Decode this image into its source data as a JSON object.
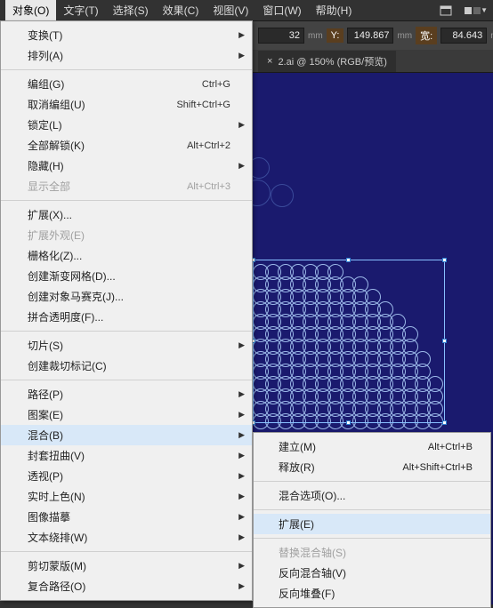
{
  "menubar": {
    "items": [
      "对象(O)",
      "文字(T)",
      "选择(S)",
      "效果(C)",
      "视图(V)",
      "窗口(W)",
      "帮助(H)"
    ]
  },
  "ctrl": {
    "x_val": "32",
    "x_unit": "mm",
    "y_lbl": "Y:",
    "y_val": "149.867",
    "y_unit": "mm",
    "w_lbl": "宽:",
    "w_val": "84.643",
    "w_unit": "mm"
  },
  "tab": {
    "name": "2.ai @ 150% (RGB/预览)",
    "close": "×"
  },
  "menu": {
    "g1": [
      {
        "l": "变换(T)",
        "a": 1
      },
      {
        "l": "排列(A)",
        "a": 1
      }
    ],
    "g2": [
      {
        "l": "编组(G)",
        "s": "Ctrl+G"
      },
      {
        "l": "取消编组(U)",
        "s": "Shift+Ctrl+G"
      },
      {
        "l": "锁定(L)",
        "a": 1
      },
      {
        "l": "全部解锁(K)",
        "s": "Alt+Ctrl+2"
      },
      {
        "l": "隐藏(H)",
        "a": 1
      },
      {
        "l": "显示全部",
        "s": "Alt+Ctrl+3",
        "d": 1
      }
    ],
    "g3": [
      {
        "l": "扩展(X)..."
      },
      {
        "l": "扩展外观(E)",
        "d": 1
      },
      {
        "l": "栅格化(Z)..."
      },
      {
        "l": "创建渐变网格(D)..."
      },
      {
        "l": "创建对象马赛克(J)..."
      },
      {
        "l": "拼合透明度(F)..."
      }
    ],
    "g4": [
      {
        "l": "切片(S)",
        "a": 1
      },
      {
        "l": "创建裁切标记(C)"
      }
    ],
    "g5": [
      {
        "l": "路径(P)",
        "a": 1
      },
      {
        "l": "图案(E)",
        "a": 1
      },
      {
        "l": "混合(B)",
        "a": 1,
        "hl": 1
      },
      {
        "l": "封套扭曲(V)",
        "a": 1
      },
      {
        "l": "透视(P)",
        "a": 1
      },
      {
        "l": "实时上色(N)",
        "a": 1
      },
      {
        "l": "图像描摹",
        "a": 1
      },
      {
        "l": "文本绕排(W)",
        "a": 1
      }
    ],
    "g6": [
      {
        "l": "剪切蒙版(M)",
        "a": 1
      },
      {
        "l": "复合路径(O)",
        "a": 1
      }
    ]
  },
  "sub": {
    "g1": [
      {
        "l": "建立(M)",
        "s": "Alt+Ctrl+B"
      },
      {
        "l": "释放(R)",
        "s": "Alt+Shift+Ctrl+B"
      }
    ],
    "g2": [
      {
        "l": "混合选项(O)..."
      }
    ],
    "g3": [
      {
        "l": "扩展(E)",
        "hl": 1
      }
    ],
    "g4": [
      {
        "l": "替换混合轴(S)",
        "d": 1
      },
      {
        "l": "反向混合轴(V)"
      },
      {
        "l": "反向堆叠(F)"
      }
    ]
  }
}
